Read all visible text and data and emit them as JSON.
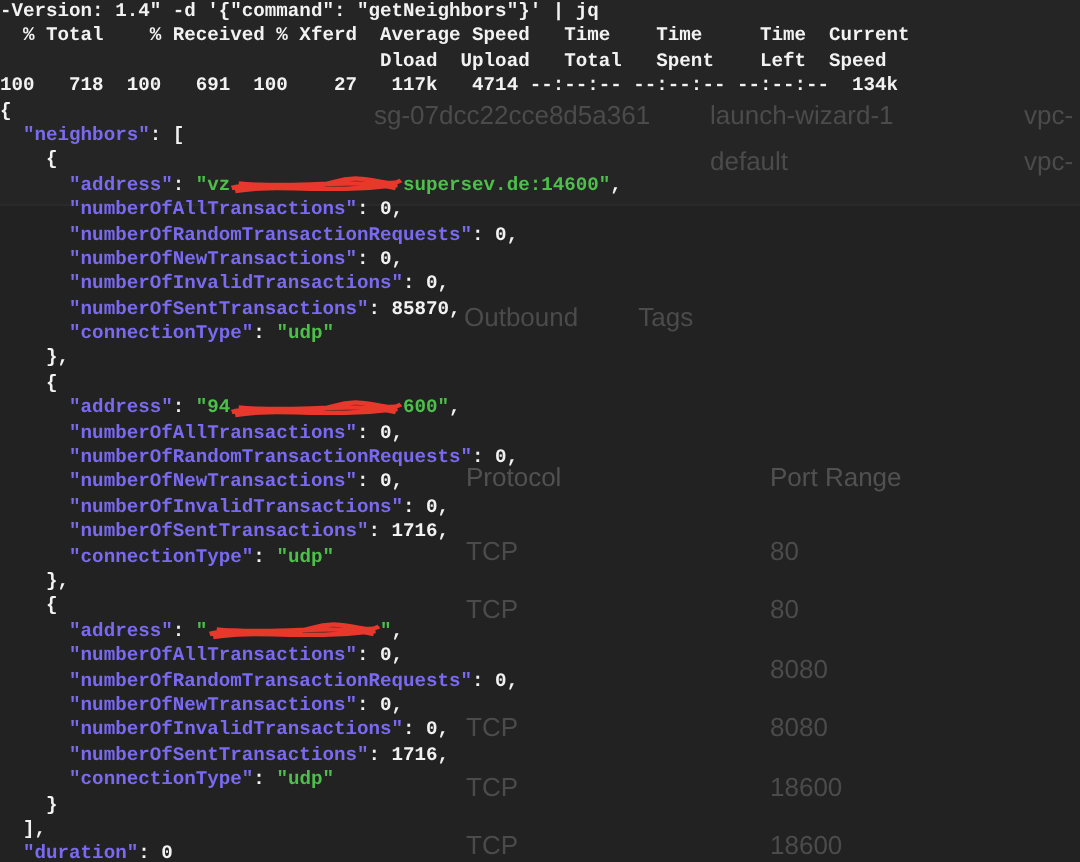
{
  "console_window": {
    "groups": [
      {
        "group_id": "sg-07dcc22cce8d5a361",
        "group_name": "launch-wizard-1",
        "vpc": "vpc-"
      },
      {
        "group_name": "default",
        "vpc": "vpc-"
      }
    ],
    "tabs": [
      {
        "label": "Outbound"
      },
      {
        "label": "Tags"
      }
    ],
    "rule_columns": [
      "Protocol",
      "Port Range"
    ],
    "rules": [
      {
        "protocol": "TCP",
        "port_range": "80"
      },
      {
        "protocol": "TCP",
        "port_range": "80"
      },
      {
        "port_range": "8080"
      },
      {
        "protocol": "TCP",
        "port_range": "8080"
      },
      {
        "protocol": "TCP",
        "port_range": "18600"
      },
      {
        "protocol": "TCP",
        "port_range": "18600"
      }
    ]
  },
  "terminal_lines": [
    [
      {
        "text": "-Version: 1.4\" -d '{\"command\": \"getNeighbors\"}' | jq",
        "kind": "punct"
      }
    ],
    [
      {
        "text": "  % Total    % Received % Xferd  Average Speed   Time    Time     Time  Current",
        "kind": "punct"
      }
    ],
    [
      {
        "text": "                                 Dload  Upload   Total   Spent    Left  Speed",
        "kind": "punct"
      }
    ],
    [
      {
        "text": "100   718  100   691  100    27   117k   4714 --:--:-- --:--:-- --:--:--  134k",
        "kind": "punct"
      }
    ],
    [
      {
        "text": "{",
        "kind": "punct"
      }
    ],
    [
      {
        "text": "  \"neighbors\"",
        "kind": "key"
      },
      {
        "text": ": [",
        "kind": "punct"
      }
    ],
    [
      {
        "text": "    {",
        "kind": "punct"
      }
    ],
    [
      {
        "text": "      \"address\"",
        "kind": "key"
      },
      {
        "text": ": ",
        "kind": "punct"
      },
      {
        "text": "\"vz",
        "kind": "string"
      },
      {
        "kind": "redacted"
      },
      {
        "text": "supersev.de:14600\"",
        "kind": "string"
      },
      {
        "text": ",",
        "kind": "punct"
      }
    ],
    [
      {
        "text": "      \"numberOfAllTransactions\"",
        "kind": "key"
      },
      {
        "text": ": 0,",
        "kind": "punct"
      }
    ],
    [
      {
        "text": "      \"numberOfRandomTransactionRequests\"",
        "kind": "key"
      },
      {
        "text": ": 0,",
        "kind": "punct"
      }
    ],
    [
      {
        "text": "      \"numberOfNewTransactions\"",
        "kind": "key"
      },
      {
        "text": ": 0,",
        "kind": "punct"
      }
    ],
    [
      {
        "text": "      \"numberOfInvalidTransactions\"",
        "kind": "key"
      },
      {
        "text": ": 0,",
        "kind": "punct"
      }
    ],
    [
      {
        "text": "      \"numberOfSentTransactions\"",
        "kind": "key"
      },
      {
        "text": ": 85870,",
        "kind": "punct"
      }
    ],
    [
      {
        "text": "      \"connectionType\"",
        "kind": "key"
      },
      {
        "text": ": ",
        "kind": "punct"
      },
      {
        "text": "\"udp\"",
        "kind": "string"
      }
    ],
    [
      {
        "text": "    },",
        "kind": "punct"
      }
    ],
    [
      {
        "text": "    {",
        "kind": "punct"
      }
    ],
    [
      {
        "text": "      \"address\"",
        "kind": "key"
      },
      {
        "text": ": ",
        "kind": "punct"
      },
      {
        "text": "\"94",
        "kind": "string"
      },
      {
        "kind": "redacted"
      },
      {
        "text": "600\"",
        "kind": "string"
      },
      {
        "text": ",",
        "kind": "punct"
      }
    ],
    [
      {
        "text": "      \"numberOfAllTransactions\"",
        "kind": "key"
      },
      {
        "text": ": 0,",
        "kind": "punct"
      }
    ],
    [
      {
        "text": "      \"numberOfRandomTransactionRequests\"",
        "kind": "key"
      },
      {
        "text": ": 0,",
        "kind": "punct"
      }
    ],
    [
      {
        "text": "      \"numberOfNewTransactions\"",
        "kind": "key"
      },
      {
        "text": ": 0,",
        "kind": "punct"
      }
    ],
    [
      {
        "text": "      \"numberOfInvalidTransactions\"",
        "kind": "key"
      },
      {
        "text": ": 0,",
        "kind": "punct"
      }
    ],
    [
      {
        "text": "      \"numberOfSentTransactions\"",
        "kind": "key"
      },
      {
        "text": ": 1716,",
        "kind": "punct"
      }
    ],
    [
      {
        "text": "      \"connectionType\"",
        "kind": "key"
      },
      {
        "text": ": ",
        "kind": "punct"
      },
      {
        "text": "\"udp\"",
        "kind": "string"
      }
    ],
    [
      {
        "text": "    },",
        "kind": "punct"
      }
    ],
    [
      {
        "text": "    {",
        "kind": "punct"
      }
    ],
    [
      {
        "text": "      \"address\"",
        "kind": "key"
      },
      {
        "text": ": ",
        "kind": "punct"
      },
      {
        "text": "\"",
        "kind": "string"
      },
      {
        "kind": "redacted"
      },
      {
        "text": "\"",
        "kind": "string"
      },
      {
        "text": ",",
        "kind": "punct"
      }
    ],
    [
      {
        "text": "      \"numberOfAllTransactions\"",
        "kind": "key"
      },
      {
        "text": ": 0,",
        "kind": "punct"
      }
    ],
    [
      {
        "text": "      \"numberOfRandomTransactionRequests\"",
        "kind": "key"
      },
      {
        "text": ": 0,",
        "kind": "punct"
      }
    ],
    [
      {
        "text": "      \"numberOfNewTransactions\"",
        "kind": "key"
      },
      {
        "text": ": 0,",
        "kind": "punct"
      }
    ],
    [
      {
        "text": "      \"numberOfInvalidTransactions\"",
        "kind": "key"
      },
      {
        "text": ": 0,",
        "kind": "punct"
      }
    ],
    [
      {
        "text": "      \"numberOfSentTransactions\"",
        "kind": "key"
      },
      {
        "text": ": 1716,",
        "kind": "punct"
      }
    ],
    [
      {
        "text": "      \"connectionType\"",
        "kind": "key"
      },
      {
        "text": ": ",
        "kind": "punct"
      },
      {
        "text": "\"udp\"",
        "kind": "string"
      }
    ],
    [
      {
        "text": "    }",
        "kind": "punct"
      }
    ],
    [
      {
        "text": "  ],",
        "kind": "punct"
      }
    ],
    [
      {
        "text": "  \"duration\"",
        "kind": "key"
      },
      {
        "text": ": 0",
        "kind": "punct"
      }
    ]
  ]
}
